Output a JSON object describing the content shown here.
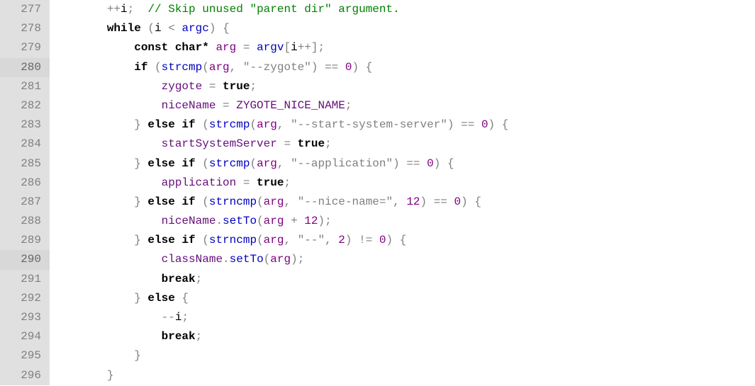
{
  "lines": [
    {
      "num": "277",
      "hl": false,
      "tokens": [
        {
          "t": "        ",
          "c": ""
        },
        {
          "t": "++",
          "c": "op"
        },
        {
          "t": "i",
          "c": ""
        },
        {
          "t": ";  ",
          "c": "op"
        },
        {
          "t": "// Skip unused \"parent dir\" argument.",
          "c": "cm"
        }
      ]
    },
    {
      "num": "278",
      "hl": false,
      "tokens": [
        {
          "t": "        ",
          "c": ""
        },
        {
          "t": "while",
          "c": "kw"
        },
        {
          "t": " (",
          "c": "op"
        },
        {
          "t": "i ",
          "c": ""
        },
        {
          "t": "<",
          "c": "op"
        },
        {
          "t": " ",
          "c": ""
        },
        {
          "t": "argc",
          "c": "fn"
        },
        {
          "t": ") {",
          "c": "op"
        }
      ]
    },
    {
      "num": "279",
      "hl": false,
      "tokens": [
        {
          "t": "            ",
          "c": ""
        },
        {
          "t": "const char*",
          "c": "kw"
        },
        {
          "t": " ",
          "c": ""
        },
        {
          "t": "arg",
          "c": "nm"
        },
        {
          "t": " = ",
          "c": "op"
        },
        {
          "t": "argv",
          "c": "fn"
        },
        {
          "t": "[",
          "c": "op"
        },
        {
          "t": "i",
          "c": ""
        },
        {
          "t": "++];",
          "c": "op"
        }
      ]
    },
    {
      "num": "280",
      "hl": true,
      "tokens": [
        {
          "t": "            ",
          "c": ""
        },
        {
          "t": "if",
          "c": "kw"
        },
        {
          "t": " (",
          "c": "op"
        },
        {
          "t": "strcmp",
          "c": "fn"
        },
        {
          "t": "(",
          "c": "op"
        },
        {
          "t": "arg",
          "c": "nm"
        },
        {
          "t": ", ",
          "c": "op"
        },
        {
          "t": "\"--zygote\"",
          "c": "str"
        },
        {
          "t": ") == ",
          "c": "op"
        },
        {
          "t": "0",
          "c": "num"
        },
        {
          "t": ") {",
          "c": "op"
        }
      ]
    },
    {
      "num": "281",
      "hl": false,
      "tokens": [
        {
          "t": "                ",
          "c": ""
        },
        {
          "t": "zygote ",
          "c": "var"
        },
        {
          "t": "= ",
          "c": "op"
        },
        {
          "t": "true",
          "c": "kw"
        },
        {
          "t": ";",
          "c": "op"
        }
      ]
    },
    {
      "num": "282",
      "hl": false,
      "tokens": [
        {
          "t": "                ",
          "c": ""
        },
        {
          "t": "niceName ",
          "c": "var"
        },
        {
          "t": "= ",
          "c": "op"
        },
        {
          "t": "ZYGOTE_NICE_NAME",
          "c": "const"
        },
        {
          "t": ";",
          "c": "op"
        }
      ]
    },
    {
      "num": "283",
      "hl": false,
      "tokens": [
        {
          "t": "            ",
          "c": ""
        },
        {
          "t": "} ",
          "c": "op"
        },
        {
          "t": "else if",
          "c": "kw"
        },
        {
          "t": " (",
          "c": "op"
        },
        {
          "t": "strcmp",
          "c": "fn"
        },
        {
          "t": "(",
          "c": "op"
        },
        {
          "t": "arg",
          "c": "nm"
        },
        {
          "t": ", ",
          "c": "op"
        },
        {
          "t": "\"--start-system-server\"",
          "c": "str"
        },
        {
          "t": ") == ",
          "c": "op"
        },
        {
          "t": "0",
          "c": "num"
        },
        {
          "t": ") {",
          "c": "op"
        }
      ]
    },
    {
      "num": "284",
      "hl": false,
      "tokens": [
        {
          "t": "                ",
          "c": ""
        },
        {
          "t": "startSystemServer ",
          "c": "var"
        },
        {
          "t": "= ",
          "c": "op"
        },
        {
          "t": "true",
          "c": "kw"
        },
        {
          "t": ";",
          "c": "op"
        }
      ]
    },
    {
      "num": "285",
      "hl": false,
      "tokens": [
        {
          "t": "            ",
          "c": ""
        },
        {
          "t": "} ",
          "c": "op"
        },
        {
          "t": "else if",
          "c": "kw"
        },
        {
          "t": " (",
          "c": "op"
        },
        {
          "t": "strcmp",
          "c": "fn"
        },
        {
          "t": "(",
          "c": "op"
        },
        {
          "t": "arg",
          "c": "nm"
        },
        {
          "t": ", ",
          "c": "op"
        },
        {
          "t": "\"--application\"",
          "c": "str"
        },
        {
          "t": ") == ",
          "c": "op"
        },
        {
          "t": "0",
          "c": "num"
        },
        {
          "t": ") {",
          "c": "op"
        }
      ]
    },
    {
      "num": "286",
      "hl": false,
      "tokens": [
        {
          "t": "                ",
          "c": ""
        },
        {
          "t": "application ",
          "c": "var"
        },
        {
          "t": "= ",
          "c": "op"
        },
        {
          "t": "true",
          "c": "kw"
        },
        {
          "t": ";",
          "c": "op"
        }
      ]
    },
    {
      "num": "287",
      "hl": false,
      "tokens": [
        {
          "t": "            ",
          "c": ""
        },
        {
          "t": "} ",
          "c": "op"
        },
        {
          "t": "else if",
          "c": "kw"
        },
        {
          "t": " (",
          "c": "op"
        },
        {
          "t": "strncmp",
          "c": "fn"
        },
        {
          "t": "(",
          "c": "op"
        },
        {
          "t": "arg",
          "c": "nm"
        },
        {
          "t": ", ",
          "c": "op"
        },
        {
          "t": "\"--nice-name=\"",
          "c": "str"
        },
        {
          "t": ", ",
          "c": "op"
        },
        {
          "t": "12",
          "c": "num"
        },
        {
          "t": ") == ",
          "c": "op"
        },
        {
          "t": "0",
          "c": "num"
        },
        {
          "t": ") {",
          "c": "op"
        }
      ]
    },
    {
      "num": "288",
      "hl": false,
      "tokens": [
        {
          "t": "                ",
          "c": ""
        },
        {
          "t": "niceName",
          "c": "var"
        },
        {
          "t": ".",
          "c": "op"
        },
        {
          "t": "setTo",
          "c": "fn"
        },
        {
          "t": "(",
          "c": "op"
        },
        {
          "t": "arg",
          "c": "nm"
        },
        {
          "t": " + ",
          "c": "op"
        },
        {
          "t": "12",
          "c": "num"
        },
        {
          "t": ");",
          "c": "op"
        }
      ]
    },
    {
      "num": "289",
      "hl": false,
      "tokens": [
        {
          "t": "            ",
          "c": ""
        },
        {
          "t": "} ",
          "c": "op"
        },
        {
          "t": "else if",
          "c": "kw"
        },
        {
          "t": " (",
          "c": "op"
        },
        {
          "t": "strncmp",
          "c": "fn"
        },
        {
          "t": "(",
          "c": "op"
        },
        {
          "t": "arg",
          "c": "nm"
        },
        {
          "t": ", ",
          "c": "op"
        },
        {
          "t": "\"--\"",
          "c": "str"
        },
        {
          "t": ", ",
          "c": "op"
        },
        {
          "t": "2",
          "c": "num"
        },
        {
          "t": ") != ",
          "c": "op"
        },
        {
          "t": "0",
          "c": "num"
        },
        {
          "t": ") {",
          "c": "op"
        }
      ]
    },
    {
      "num": "290",
      "hl": true,
      "tokens": [
        {
          "t": "                ",
          "c": ""
        },
        {
          "t": "className",
          "c": "var"
        },
        {
          "t": ".",
          "c": "op"
        },
        {
          "t": "setTo",
          "c": "fn"
        },
        {
          "t": "(",
          "c": "op"
        },
        {
          "t": "arg",
          "c": "nm"
        },
        {
          "t": ");",
          "c": "op"
        }
      ]
    },
    {
      "num": "291",
      "hl": false,
      "tokens": [
        {
          "t": "                ",
          "c": ""
        },
        {
          "t": "break",
          "c": "kw"
        },
        {
          "t": ";",
          "c": "op"
        }
      ]
    },
    {
      "num": "292",
      "hl": false,
      "tokens": [
        {
          "t": "            ",
          "c": ""
        },
        {
          "t": "} ",
          "c": "op"
        },
        {
          "t": "else",
          "c": "kw"
        },
        {
          "t": " {",
          "c": "op"
        }
      ]
    },
    {
      "num": "293",
      "hl": false,
      "tokens": [
        {
          "t": "                ",
          "c": ""
        },
        {
          "t": "--",
          "c": "op"
        },
        {
          "t": "i",
          "c": ""
        },
        {
          "t": ";",
          "c": "op"
        }
      ]
    },
    {
      "num": "294",
      "hl": false,
      "tokens": [
        {
          "t": "                ",
          "c": ""
        },
        {
          "t": "break",
          "c": "kw"
        },
        {
          "t": ";",
          "c": "op"
        }
      ]
    },
    {
      "num": "295",
      "hl": false,
      "tokens": [
        {
          "t": "            ",
          "c": ""
        },
        {
          "t": "}",
          "c": "op"
        }
      ]
    },
    {
      "num": "296",
      "hl": false,
      "tokens": [
        {
          "t": "        ",
          "c": ""
        },
        {
          "t": "}",
          "c": "op"
        }
      ]
    }
  ]
}
